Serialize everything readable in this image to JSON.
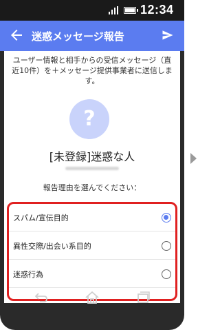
{
  "status_bar": {
    "time": "12:34"
  },
  "app_bar": {
    "title": "迷惑メッセージ報告",
    "back_icon": "arrow-left-icon",
    "send_icon": "send-icon"
  },
  "description": "ユーザー情報と相手からの受信メッセージ（直近10件）を＋メッセージ提供事業者に送信します。",
  "contact": {
    "avatar_glyph": "?",
    "name": "[未登録]迷惑な人"
  },
  "prompt": "報告理由を選んでください：",
  "options": [
    {
      "label": "スパム/宣伝目的",
      "selected": true
    },
    {
      "label": "異性交際/出会い系目的",
      "selected": false
    },
    {
      "label": "迷惑行為",
      "selected": false
    }
  ],
  "nav_bar": {
    "icons": [
      "back-icon",
      "home-icon",
      "recents-icon"
    ]
  },
  "colors": {
    "accent": "#5b7cf0",
    "highlight_border": "#e02020",
    "avatar_bg": "#c9d3fb"
  }
}
